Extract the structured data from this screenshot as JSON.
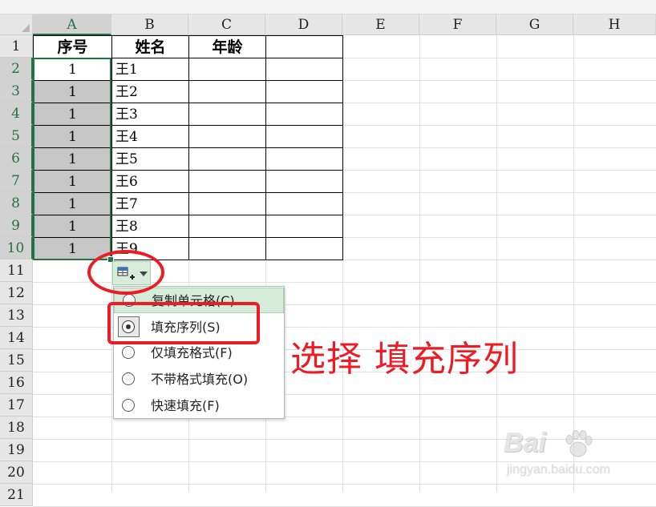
{
  "columns": [
    "A",
    "B",
    "C",
    "D",
    "E",
    "F",
    "G",
    "H"
  ],
  "rows": [
    "1",
    "2",
    "3",
    "4",
    "5",
    "6",
    "7",
    "8",
    "9",
    "10",
    "11",
    "12",
    "13",
    "14",
    "15",
    "16",
    "17",
    "18",
    "19",
    "20",
    "21"
  ],
  "header_row": {
    "a": "序号",
    "b": "姓名",
    "c": "年龄"
  },
  "data_rows": [
    {
      "a": "1",
      "b": "王1"
    },
    {
      "a": "1",
      "b": "王2"
    },
    {
      "a": "1",
      "b": "王3"
    },
    {
      "a": "1",
      "b": "王4"
    },
    {
      "a": "1",
      "b": "王5"
    },
    {
      "a": "1",
      "b": "王6"
    },
    {
      "a": "1",
      "b": "王7"
    },
    {
      "a": "1",
      "b": "王8"
    },
    {
      "a": "1",
      "b": "王9"
    }
  ],
  "autofill_menu": {
    "items": [
      {
        "label": "复制单元格(C)",
        "checked": false
      },
      {
        "label": "填充序列(S)",
        "checked": true
      },
      {
        "label": "仅填充格式(F)",
        "checked": false
      },
      {
        "label": "不带格式填充(O)",
        "checked": false
      },
      {
        "label": "快速填充(F)",
        "checked": false
      }
    ]
  },
  "annotation": "选择 填充序列",
  "watermark": {
    "brand": "Bai",
    "site": "jingyan.baidu.com"
  },
  "colors": {
    "accent": "#217346",
    "highlight": "#ec1c24",
    "selection": "#c6c6c6"
  }
}
